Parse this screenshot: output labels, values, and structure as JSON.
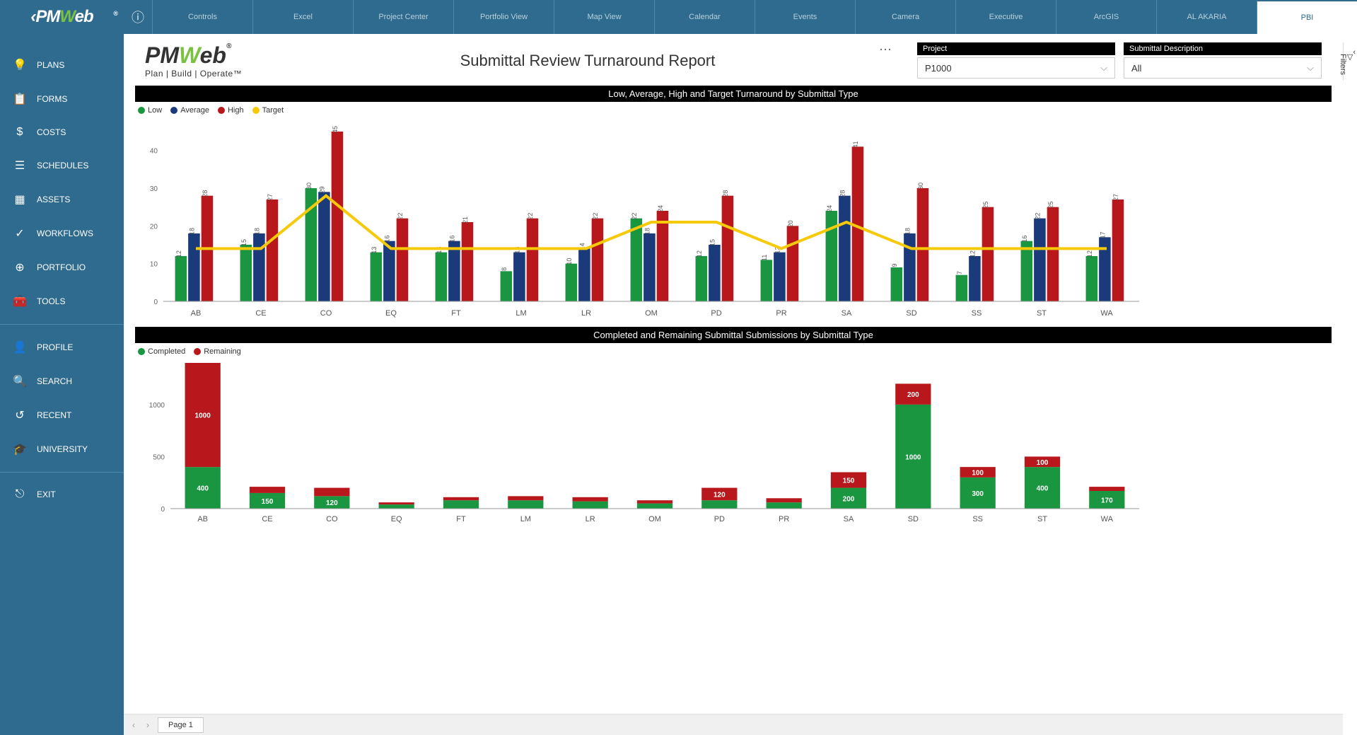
{
  "app": {
    "logo_left": "‹PM",
    "logo_w": "W",
    "logo_right": "eb",
    "reg": "®"
  },
  "top_tabs": [
    "Controls",
    "Excel",
    "Project Center",
    "Portfolio View",
    "Map View",
    "Calendar",
    "Events",
    "Camera",
    "Executive",
    "ArcGIS",
    "AL AKARIA",
    "PBI"
  ],
  "sidebar": [
    {
      "icon": "💡",
      "label": "PLANS"
    },
    {
      "icon": "📋",
      "label": "FORMS"
    },
    {
      "icon": "$",
      "label": "COSTS"
    },
    {
      "icon": "☰",
      "label": "SCHEDULES"
    },
    {
      "icon": "▦",
      "label": "ASSETS"
    },
    {
      "icon": "✓",
      "label": "WORKFLOWS"
    },
    {
      "icon": "⊕",
      "label": "PORTFOLIO"
    },
    {
      "icon": "🧰",
      "label": "TOOLS"
    },
    {
      "type": "divider"
    },
    {
      "icon": "👤",
      "label": "PROFILE"
    },
    {
      "icon": "🔍",
      "label": "SEARCH"
    },
    {
      "icon": "↺",
      "label": "RECENT"
    },
    {
      "icon": "🎓",
      "label": "UNIVERSITY"
    },
    {
      "type": "divider"
    },
    {
      "icon": "⎋",
      "label": "EXIT"
    }
  ],
  "report": {
    "logo_main": "PMWeb",
    "logo_tag": "Plan | Build | Operate™",
    "title": "Submittal Review Turnaround Report",
    "filters": [
      {
        "label": "Project",
        "value": "P1000"
      },
      {
        "label": "Submittal Description",
        "value": "All"
      }
    ]
  },
  "filters_side": "Filters",
  "pager": {
    "page_label": "Page 1"
  },
  "colors": {
    "low": "#1a9641",
    "average": "#1a3a7a",
    "high": "#b8181b",
    "target": "#f6c909",
    "completed": "#1a9641",
    "remaining": "#b8181b"
  },
  "chart_data": [
    {
      "id": "chart1",
      "title": "Low, Average, High and Target Turnaround by Submittal Type",
      "type": "bar",
      "categories": [
        "AB",
        "CE",
        "CO",
        "EQ",
        "FT",
        "LM",
        "LR",
        "OM",
        "PD",
        "PR",
        "SA",
        "SD",
        "SS",
        "ST",
        "WA"
      ],
      "series": [
        {
          "name": "Low",
          "color": "#1a9641",
          "values": [
            12,
            15,
            30,
            13,
            13,
            8,
            10,
            22,
            12,
            11,
            24,
            9,
            7,
            16,
            12
          ]
        },
        {
          "name": "Average",
          "color": "#1a3a7a",
          "values": [
            18,
            18,
            29,
            16,
            16,
            13,
            14,
            18,
            15,
            13,
            28,
            18,
            12,
            22,
            17
          ]
        },
        {
          "name": "High",
          "color": "#b8181b",
          "values": [
            28,
            27,
            45,
            22,
            21,
            22,
            22,
            24,
            28,
            20,
            41,
            30,
            25,
            25,
            27
          ]
        }
      ],
      "line": {
        "name": "Target",
        "color": "#f6c909",
        "values": [
          14,
          14,
          28,
          14,
          14,
          14,
          14,
          21,
          21,
          14,
          21,
          14,
          14,
          14,
          14
        ]
      },
      "ylabel": "",
      "xlabel": "",
      "ylim": [
        0,
        45
      ],
      "yticks": [
        0,
        10,
        20,
        30,
        40
      ]
    },
    {
      "id": "chart2",
      "title": "Completed and Remaining Submittal Submissions by Submittal Type",
      "type": "stacked-bar",
      "categories": [
        "AB",
        "CE",
        "CO",
        "EQ",
        "FT",
        "LM",
        "LR",
        "OM",
        "PD",
        "PR",
        "SA",
        "SD",
        "SS",
        "ST",
        "WA"
      ],
      "series": [
        {
          "name": "Completed",
          "color": "#1a9641",
          "values": [
            400,
            150,
            120,
            40,
            80,
            80,
            70,
            50,
            80,
            60,
            200,
            1000,
            300,
            400,
            170
          ]
        },
        {
          "name": "Remaining",
          "color": "#b8181b",
          "values": [
            1000,
            60,
            80,
            20,
            30,
            40,
            40,
            30,
            120,
            40,
            150,
            200,
            100,
            100,
            40
          ]
        }
      ],
      "labels_show_threshold": 100,
      "ylabel": "",
      "xlabel": "",
      "ylim": [
        0,
        1400
      ],
      "yticks": [
        0,
        500,
        1000
      ]
    }
  ]
}
